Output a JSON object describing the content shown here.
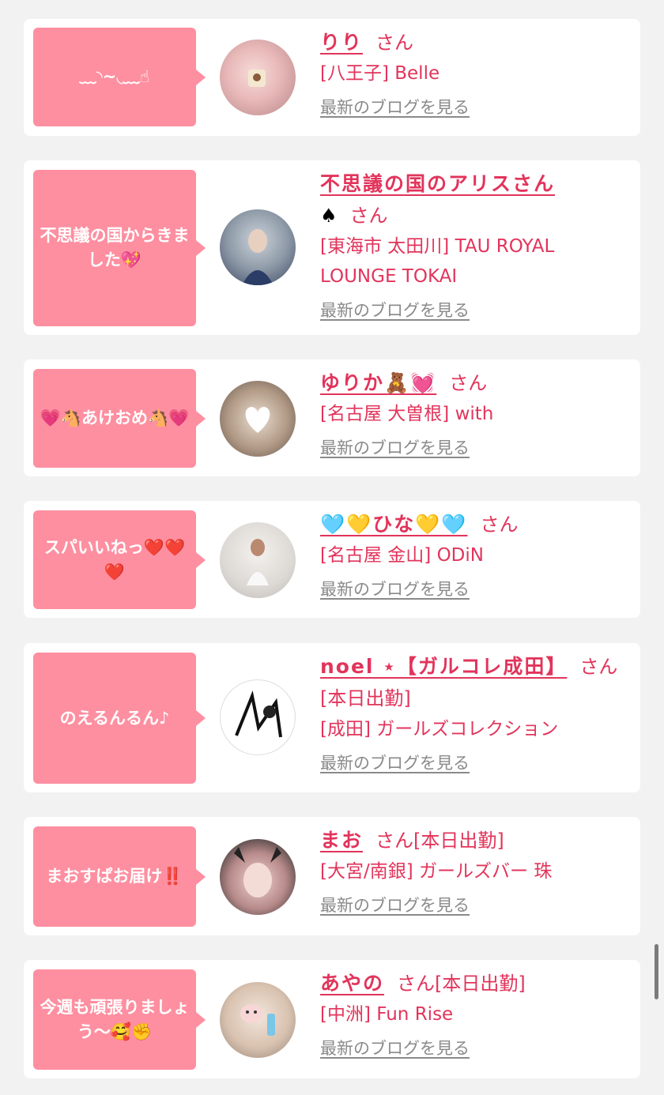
{
  "entries": [
    {
      "message": "﹏◝~◟﹏☝",
      "name": "りり",
      "suffix": "さん",
      "shop": "[八王子] Belle",
      "link": "最新のブログを見る"
    },
    {
      "message": "不思議の国からきました💖",
      "name": "不思議の国のアリスさん",
      "name_extra": "♠",
      "suffix": "さん",
      "shop": "[東海市 太田川] TAU ROYAL LOUNGE TOKAI",
      "link": "最新のブログを見る"
    },
    {
      "message": "💗🐴あけおめ🐴💗",
      "name": "ゆりか🧸💓",
      "suffix": "さん",
      "shop": "[名古屋 大曽根] with",
      "link": "最新のブログを見る"
    },
    {
      "message": "スパいいねっ❤️❤️❤️",
      "name": "🩵💛ひな💛🩵",
      "suffix": "さん",
      "shop": "[名古屋 金山] ODiN",
      "link": "最新のブログを見る"
    },
    {
      "message": "のえるんるん♪",
      "name": "noel ⋆【ガルコレ成田】",
      "suffix": "さん[本日出勤]",
      "shop": "[成田] ガールズコレクション",
      "link": "最新のブログを見る"
    },
    {
      "message": "まおすぱお届け‼️",
      "name": "まお",
      "suffix": "さん[本日出勤]",
      "shop": "[大宮/南銀] ガールズバー 珠",
      "link": "最新のブログを見る"
    },
    {
      "message": "今週も頑張りましょう〜🥰✊",
      "name": "あやの",
      "suffix": "さん[本日出勤]",
      "shop": "[中洲] Fun Rise",
      "link": "最新のブログを見る"
    }
  ],
  "colors": {
    "accent": "#e2345b",
    "bubble": "#fe8fa0",
    "link": "#8a8a8a",
    "background": "#f2f2f2"
  }
}
